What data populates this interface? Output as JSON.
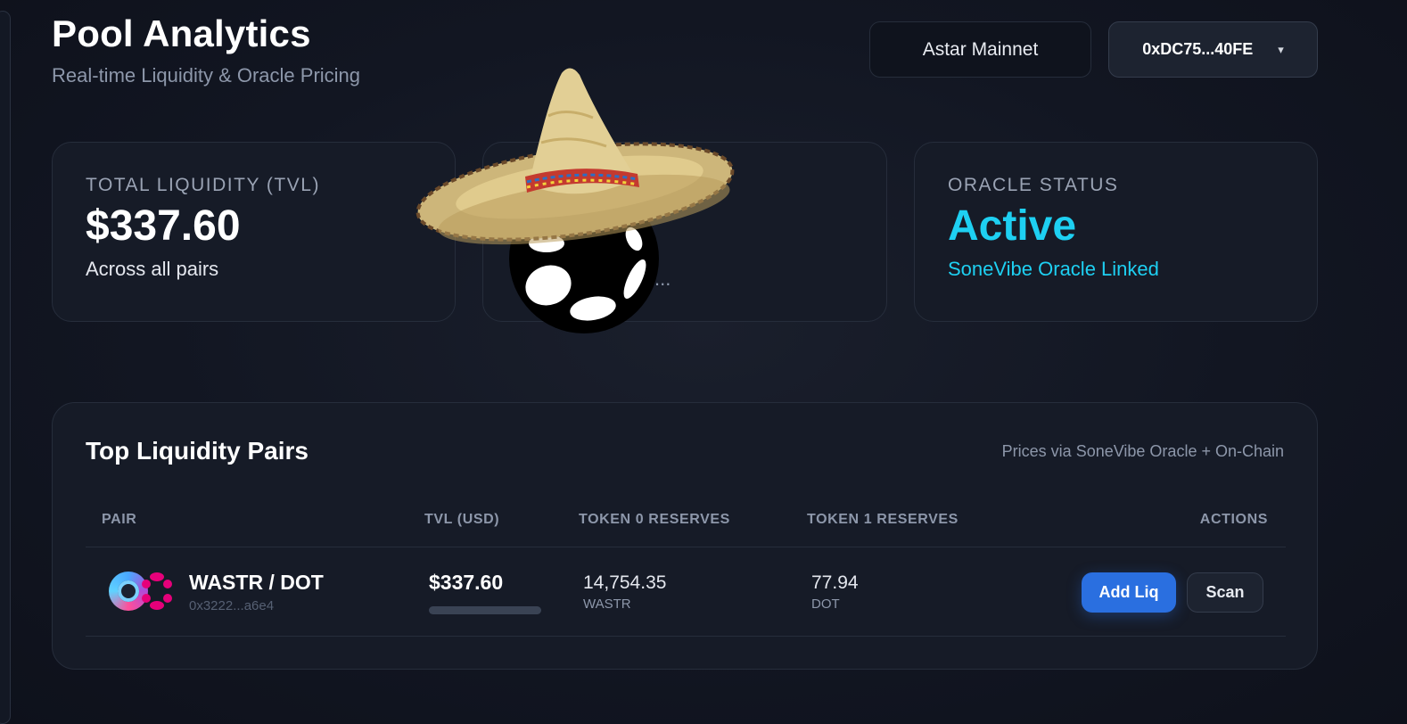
{
  "header": {
    "title": "Pool Analytics",
    "subtitle": "Real-time Liquidity & Oracle Pricing",
    "network_label": "Astar Mainnet",
    "wallet_label": "0xDC75...40FE",
    "wallet_caret": "▾"
  },
  "stats": {
    "tvl": {
      "label": "TOTAL LIQUIDITY (TVL)",
      "value": "$337.60",
      "sub": "Across all pairs"
    },
    "middle": {
      "sub_fragment": "..."
    },
    "oracle": {
      "label": "ORACLE STATUS",
      "value": "Active",
      "sub": "SoneVibe Oracle Linked"
    }
  },
  "pairs": {
    "title": "Top Liquidity Pairs",
    "note": "Prices via SoneVibe Oracle + On-Chain",
    "columns": [
      "PAIR",
      "TVL (USD)",
      "TOKEN 0 RESERVES",
      "TOKEN 1 RESERVES",
      "ACTIONS"
    ],
    "rows": [
      {
        "name": "WASTR / DOT",
        "address": "0x3222...a6e4",
        "tvl": "$337.60",
        "tvl_share": 1.0,
        "token0_amount": "14,754.35",
        "token0_symbol": "WASTR",
        "token1_amount": "77.94",
        "token1_symbol": "DOT",
        "add_liq_label": "Add Liq",
        "scan_label": "Scan"
      }
    ]
  },
  "colors": {
    "accent": "#1ed0f2",
    "primary_button": "#2a6fe0",
    "background": "#121622",
    "card": "#161b27"
  },
  "icons": {
    "mascot": "sombrero-polkadot-mascot-icon",
    "token0": "astar-token-icon",
    "token1": "polkadot-token-icon"
  }
}
